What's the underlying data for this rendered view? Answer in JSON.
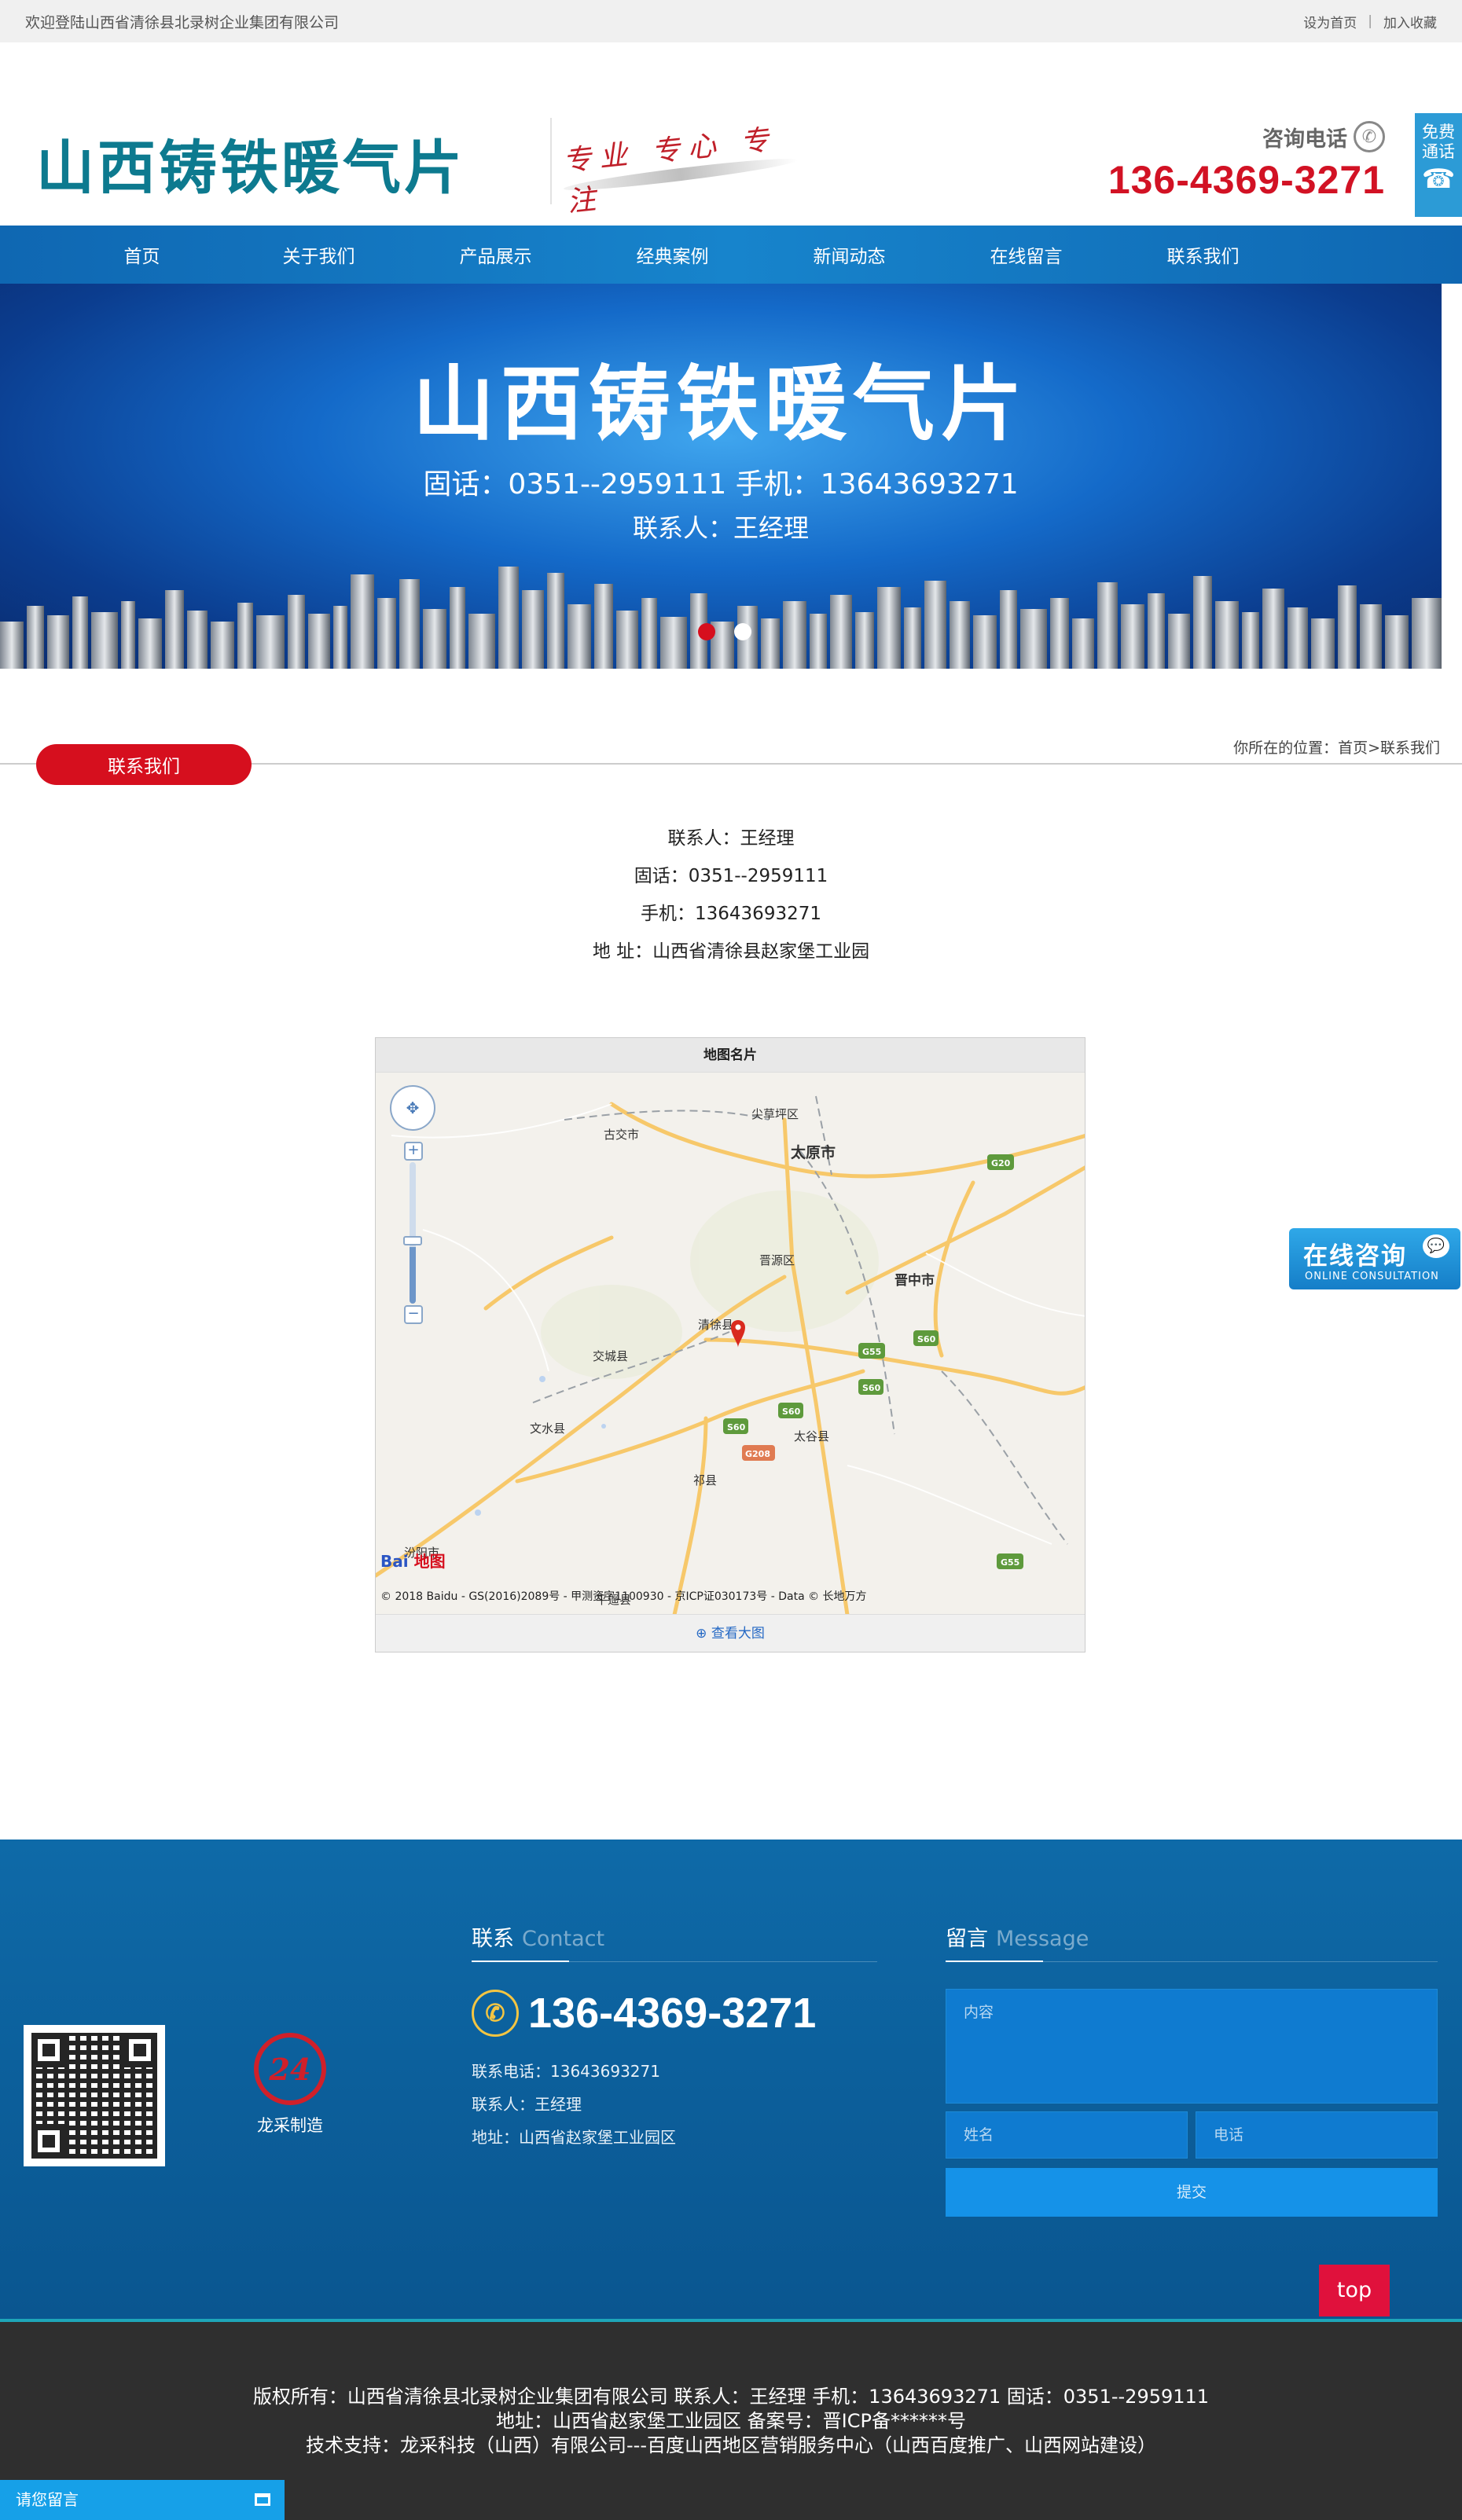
{
  "topbar": {
    "welcome": "欢迎登陆山西省清徐县北录树企业集团有限公司",
    "set_home": "设为首页",
    "separator": "|",
    "bookmark": "加入收藏"
  },
  "header": {
    "logo": "山西铸铁暖气片",
    "slogan": "专业 专心 专注",
    "consult_label": "咨询电话",
    "consult_number": "136-4369-3271",
    "free_call_line1": "免费",
    "free_call_line2": "通话"
  },
  "nav": [
    "首页",
    "关于我们",
    "产品展示",
    "经典案例",
    "新闻动态",
    "在线留言",
    "联系我们"
  ],
  "banner": {
    "title": "山西铸铁暖气片",
    "phones": "固话：0351--2959111    手机：13643693271",
    "contact": "联系人：王经理"
  },
  "section": {
    "breadcrumb": "你所在的位置：首页>联系我们",
    "badge": "联系我们"
  },
  "contact": {
    "person": "联系人：王经理",
    "landline": "固话：0351--2959111",
    "mobile": "手机：13643693271",
    "address": "地 址：山西省清徐县赵家堡工业园"
  },
  "map": {
    "title": "地图名片",
    "view_large": "查看大图",
    "copyright": "© 2018 Baidu - GS(2016)2089号 - 甲测资字1100930 - 京ICP证030173号 - Data © 长地万方",
    "logo_text": "Bai",
    "logo_suffix": "地图",
    "labels": {
      "jiancaoping": "尖草坪区",
      "gujiao": "古交市",
      "taiyuan": "太原市",
      "jinyuan": "晋源区",
      "jinzhong": "晋中市",
      "qingxu": "清徐县",
      "jiaocheng": "交城县",
      "wenshui": "文水县",
      "taigu": "太谷县",
      "qixian": "祁县",
      "fenyang": "汾阳市",
      "pingyao": "平遥县",
      "g20": "G20",
      "g55": "G55",
      "s60": "S60",
      "g208": "G208"
    }
  },
  "float_consult": {
    "cn": "在线咨询",
    "en": "ONLINE CONSULTATION"
  },
  "footer": {
    "maker_name": "龙采制造",
    "contact_title": "联系",
    "contact_title_en": "Contact",
    "big_phone": "136-4369-3271",
    "phone_line": "联系电话：13643693271",
    "person_line": "联系人：王经理",
    "address_line": "地址：山西省赵家堡工业园区",
    "message_title": "留言",
    "message_title_en": "Message",
    "placeholder_content": "内容",
    "placeholder_name": "姓名",
    "placeholder_phone": "电话",
    "submit": "提交",
    "top": "top",
    "copyright_line1": "版权所有：山西省清徐县北录树企业集团有限公司 联系人：王经理   手机：13643693271   固话：0351--2959111",
    "copyright_line2": "地址：山西省赵家堡工业园区 备案号：晋ICP备******号",
    "copyright_line3": "技术支持：龙采科技（山西）有限公司---百度山西地区营销服务中心（山西百度推广、山西网站建设）"
  },
  "leave_message": "请您留言"
}
